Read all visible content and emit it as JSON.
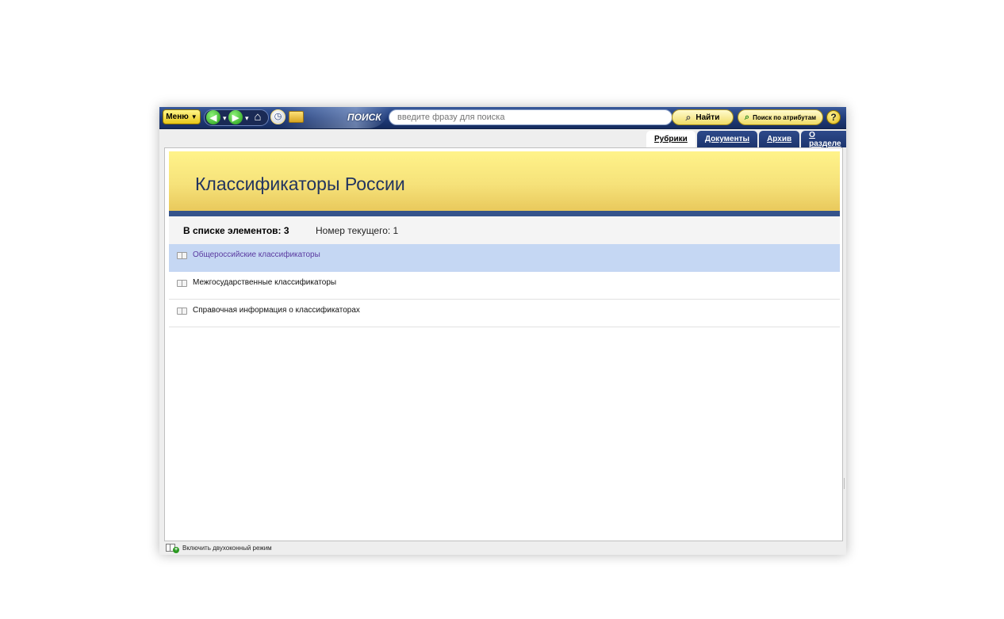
{
  "toolbar": {
    "menu_label": "Меню",
    "search_label": "ПОИСК",
    "search_placeholder": "введите фразу для поиска",
    "find_label": "Найти",
    "attr_search_label": "Поиск по атрибутам",
    "help_label": "?"
  },
  "tabs": [
    {
      "label": "Рубрики",
      "active": true
    },
    {
      "label": "Документы",
      "active": false
    },
    {
      "label": "Архив",
      "active": false
    },
    {
      "label": "О разделе",
      "active": false
    }
  ],
  "page": {
    "title": "Классификаторы России",
    "count_label": "В списке элементов: 3",
    "current_label": "Номер текущего: 1"
  },
  "list": {
    "items": [
      {
        "label": "Общероссийские классификаторы",
        "selected": true
      },
      {
        "label": "Межгосударственные классификаторы",
        "selected": false
      },
      {
        "label": "Справочная информация о классификаторах",
        "selected": false
      }
    ]
  },
  "statusbar": {
    "dual_mode_label": "Включить двухоконный режим"
  },
  "colors": {
    "toolbar": "#1f3a78",
    "tab": "#1c356e",
    "banner": "#f6e27a",
    "stripe": "#35538b",
    "selection": "#c5d7f3",
    "selected_text": "#5a3aa0"
  },
  "icons": [
    "chevron-down-icon",
    "back-arrow-icon",
    "forward-arrow-icon",
    "home-icon",
    "history-icon",
    "folder-icon",
    "magnifier-icon",
    "attribute-search-icon",
    "help-icon",
    "book-icon",
    "dual-window-icon"
  ]
}
